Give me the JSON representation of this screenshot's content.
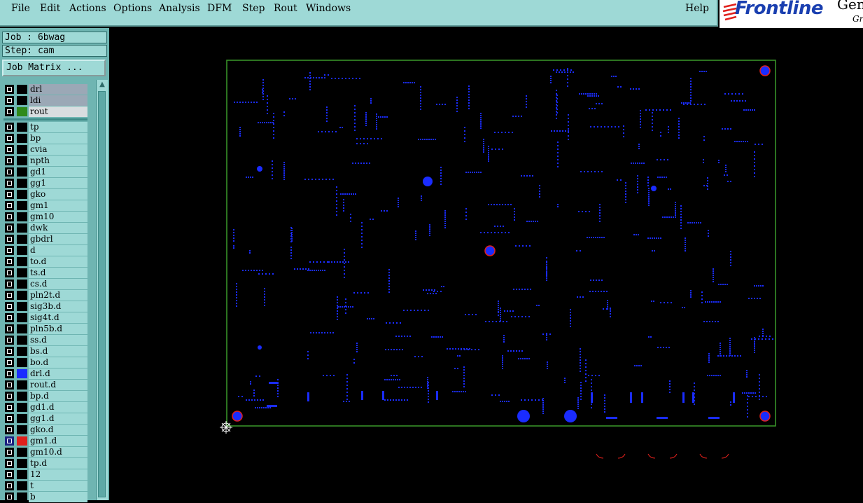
{
  "menu": [
    "File",
    "Edit",
    "Actions",
    "Options",
    "Analysis",
    "DFM",
    "Step",
    "Rout",
    "Windows"
  ],
  "help": "Help",
  "logo": {
    "brand": "Frontline",
    "gen": "Gen",
    "gr": "Gr"
  },
  "job_label": "Job : 6bwag",
  "step_label": "Step: cam",
  "job_matrix_button": "Job Matrix ...",
  "colors": {
    "panel": "#9ed9d6",
    "board": "#1a2cff",
    "outline": "#3a9a2a",
    "accent": "#e0201c"
  },
  "layers_top": [
    {
      "name": "drl",
      "color": "#000",
      "highlight": "#9ba8b6"
    },
    {
      "name": "ldi",
      "color": "#000",
      "highlight": "#9ba8b6"
    },
    {
      "name": "rout",
      "color": "#2e8a1a",
      "highlight": "#d9dde0"
    }
  ],
  "layers": [
    {
      "name": "tp"
    },
    {
      "name": "bp"
    },
    {
      "name": "cvia"
    },
    {
      "name": "npth"
    },
    {
      "name": "gd1"
    },
    {
      "name": "gg1"
    },
    {
      "name": "gko"
    },
    {
      "name": "gm1"
    },
    {
      "name": "gm10"
    },
    {
      "name": "dwk"
    },
    {
      "name": "gbdrl"
    },
    {
      "name": "d"
    },
    {
      "name": "to.d"
    },
    {
      "name": "ts.d"
    },
    {
      "name": "cs.d"
    },
    {
      "name": "pln2t.d"
    },
    {
      "name": "sig3b.d"
    },
    {
      "name": "sig4t.d"
    },
    {
      "name": "pln5b.d"
    },
    {
      "name": "ss.d"
    },
    {
      "name": "bs.d"
    },
    {
      "name": "bo.d"
    },
    {
      "name": "drl.d",
      "color": "#1a2cff"
    },
    {
      "name": "rout.d"
    },
    {
      "name": "bp.d"
    },
    {
      "name": "gd1.d"
    },
    {
      "name": "gg1.d"
    },
    {
      "name": "gko.d"
    },
    {
      "name": "gm1.d",
      "color": "#e0201c",
      "active": true
    },
    {
      "name": "gm10.d"
    },
    {
      "name": "tp.d"
    },
    {
      "name": "12"
    },
    {
      "name": "t"
    },
    {
      "name": "b"
    }
  ]
}
